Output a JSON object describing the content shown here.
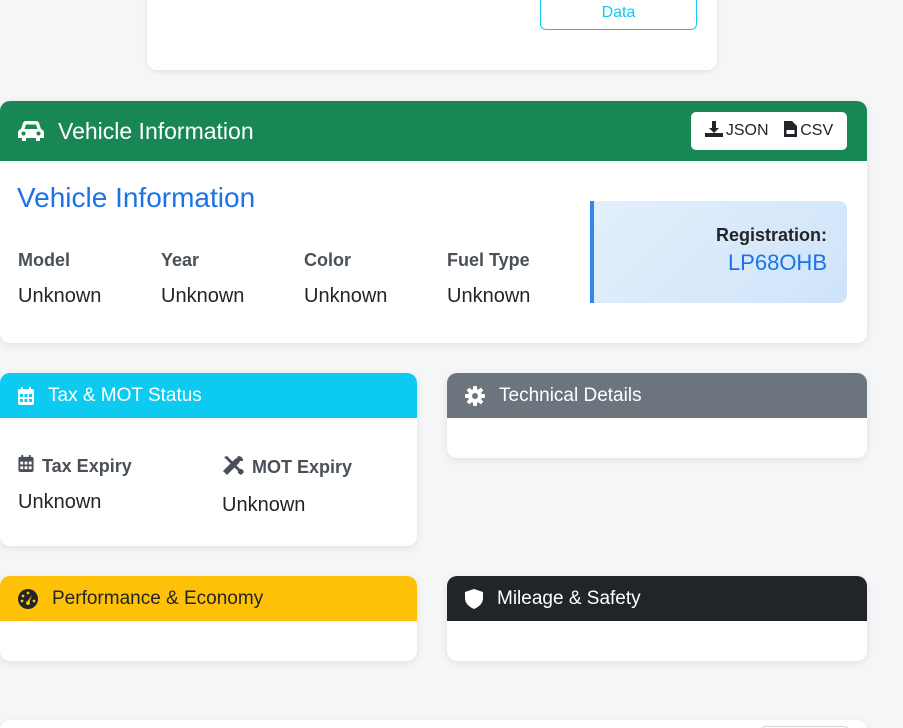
{
  "top_card": {
    "button_label": "Data"
  },
  "vehicle": {
    "header_title": "Vehicle Information",
    "export": {
      "json_label": "JSON",
      "csv_label": "CSV"
    },
    "section_title": "Vehicle Information",
    "specs": [
      {
        "label": "Model",
        "value": "Unknown"
      },
      {
        "label": "Year",
        "value": "Unknown"
      },
      {
        "label": "Color",
        "value": "Unknown"
      },
      {
        "label": "Fuel Type",
        "value": "Unknown"
      }
    ],
    "registration": {
      "label": "Registration:",
      "value": "LP68OHB"
    }
  },
  "tax_mot": {
    "header_title": "Tax & MOT Status",
    "tax": {
      "label": "Tax Expiry",
      "value": "Unknown"
    },
    "mot": {
      "label": "MOT Expiry",
      "value": "Unknown"
    }
  },
  "technical": {
    "header_title": "Technical Details"
  },
  "performance": {
    "header_title": "Performance & Economy"
  },
  "mileage": {
    "header_title": "Mileage & Safety"
  },
  "icons": {
    "vehicle": "car-icon",
    "download": "download-icon",
    "csv": "csv-file-icon",
    "calendar": "calendar-icon",
    "tools": "tools-icon",
    "gear": "gear-icon",
    "gauge": "gauge-icon",
    "shield": "shield-icon"
  },
  "colors": {
    "vehicle_header": "#198754",
    "tax_header": "#0dcaf0",
    "technical_header": "#6c757d",
    "performance_header": "#ffc107",
    "mileage_header": "#212529",
    "accent_blue": "#1a73e8"
  }
}
